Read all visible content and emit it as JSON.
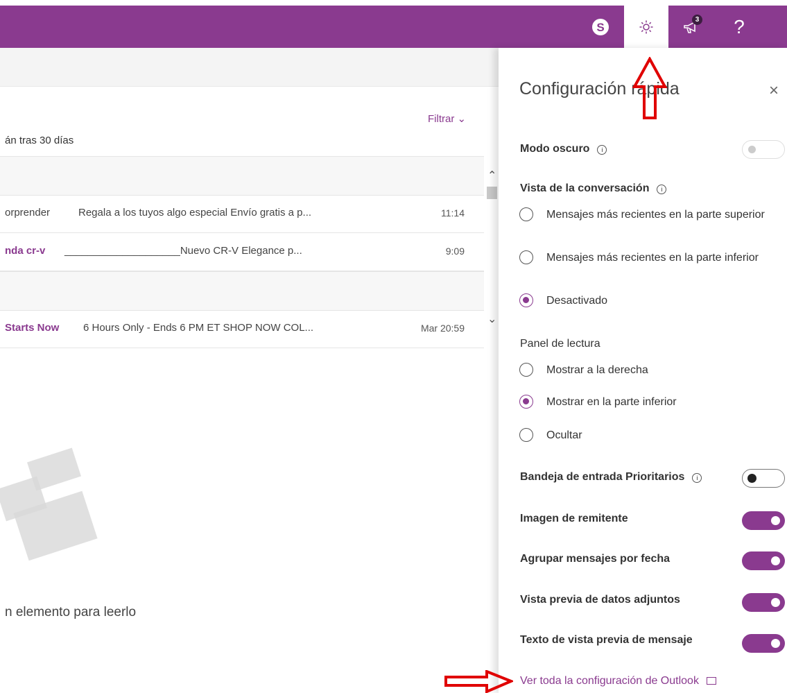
{
  "topbar": {
    "skype_icon": "skype-icon",
    "settings_icon": "settings-gear-icon",
    "feedback_icon": "megaphone-icon",
    "feedback_badge": "3",
    "help_label": "?"
  },
  "mail": {
    "filter": "Filtrar",
    "retention_text": "án tras 30 días",
    "rows": [
      {
        "from": "orprender",
        "preview": "Regala a los tuyos algo especial Envío gratis a p...",
        "time": "11:14",
        "bold": false
      },
      {
        "from": "nda cr-v",
        "preview": "____________________Nuevo CR-V Elegance p...",
        "time": "9:09",
        "bold": true
      },
      {
        "from": "Starts Now",
        "preview": "6 Hours Only - Ends 6 PM ET SHOP NOW COL...",
        "time": "Mar 20:59",
        "bold": true
      }
    ],
    "empty_text": "n elemento para leerlo"
  },
  "panel": {
    "title": "Configuración rápida",
    "dark_mode": "Modo oscuro",
    "conversation_view": "Vista de la conversación",
    "conversation_options": [
      "Mensajes más recientes en la parte superior",
      "Mensajes más recientes en la parte inferior",
      "Desactivado"
    ],
    "reading_pane": "Panel de lectura",
    "reading_options": [
      "Mostrar a la derecha",
      "Mostrar en la parte inferior",
      "Ocultar"
    ],
    "focused_inbox": "Bandeja de entrada Prioritarios",
    "sender_image": "Imagen de remitente",
    "group_by_date": "Agrupar mensajes por fecha",
    "attachment_preview": "Vista previa de datos adjuntos",
    "message_preview": "Texto de vista previa de mensaje",
    "all_settings": "Ver toda la configuración de Outlook"
  },
  "colors": {
    "brand": "#8a3a8f",
    "annotation": "#e00000"
  }
}
